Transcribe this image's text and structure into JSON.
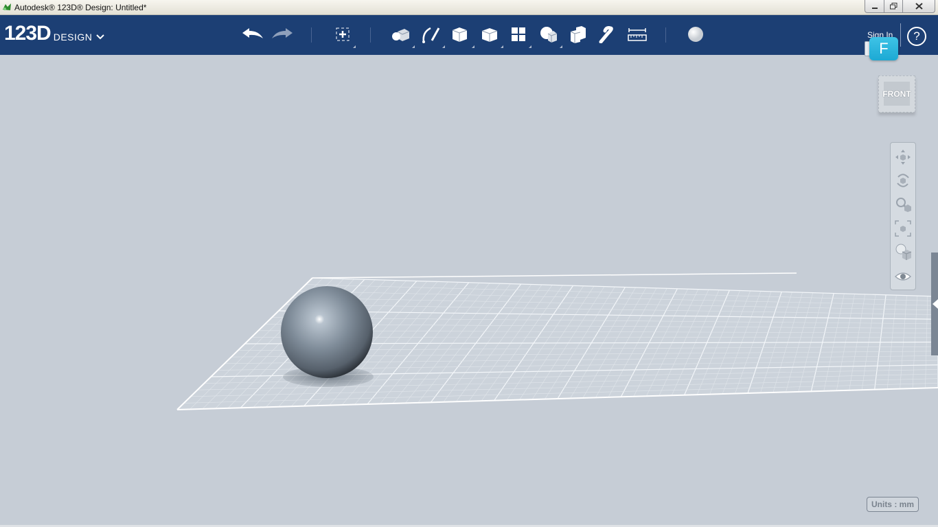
{
  "window": {
    "title": "Autodesk® 123D® Design: Untitled*",
    "controls": {
      "minimize": "minimize-icon",
      "maximize": "restore-icon",
      "close": "close-icon"
    }
  },
  "toolbar": {
    "logo_main": "123D",
    "logo_sub": "DESIGN",
    "tools": [
      {
        "name": "undo",
        "icon": "undo-icon"
      },
      {
        "name": "redo",
        "icon": "redo-icon"
      },
      {
        "name": "transform",
        "icon": "transform-icon"
      },
      {
        "name": "primitives",
        "icon": "primitives-icon"
      },
      {
        "name": "sketch",
        "icon": "sketch-icon"
      },
      {
        "name": "construct",
        "icon": "construct-icon"
      },
      {
        "name": "modify",
        "icon": "modify-icon"
      },
      {
        "name": "pattern",
        "icon": "pattern-icon"
      },
      {
        "name": "grouping",
        "icon": "grouping-icon"
      },
      {
        "name": "combine",
        "icon": "combine-icon"
      },
      {
        "name": "snap",
        "icon": "snap-icon"
      },
      {
        "name": "measure",
        "icon": "measure-icon"
      },
      {
        "name": "material",
        "icon": "material-icon"
      }
    ],
    "sign_in": "Sign In",
    "help": "?",
    "badge": "F"
  },
  "viewcube": {
    "face": "FRONT"
  },
  "nav_panel": [
    {
      "name": "pan",
      "icon": "pan-icon"
    },
    {
      "name": "orbit",
      "icon": "orbit-icon"
    },
    {
      "name": "zoom",
      "icon": "zoom-icon"
    },
    {
      "name": "fit",
      "icon": "fit-icon"
    },
    {
      "name": "view-mode",
      "icon": "view-mode-icon"
    },
    {
      "name": "visibility",
      "icon": "eye-icon"
    }
  ],
  "status": {
    "units": "Units : mm"
  },
  "colors": {
    "toolbar": "#1c3f74",
    "canvas": "#c6cdd6",
    "badge": "#2bb6dd"
  }
}
